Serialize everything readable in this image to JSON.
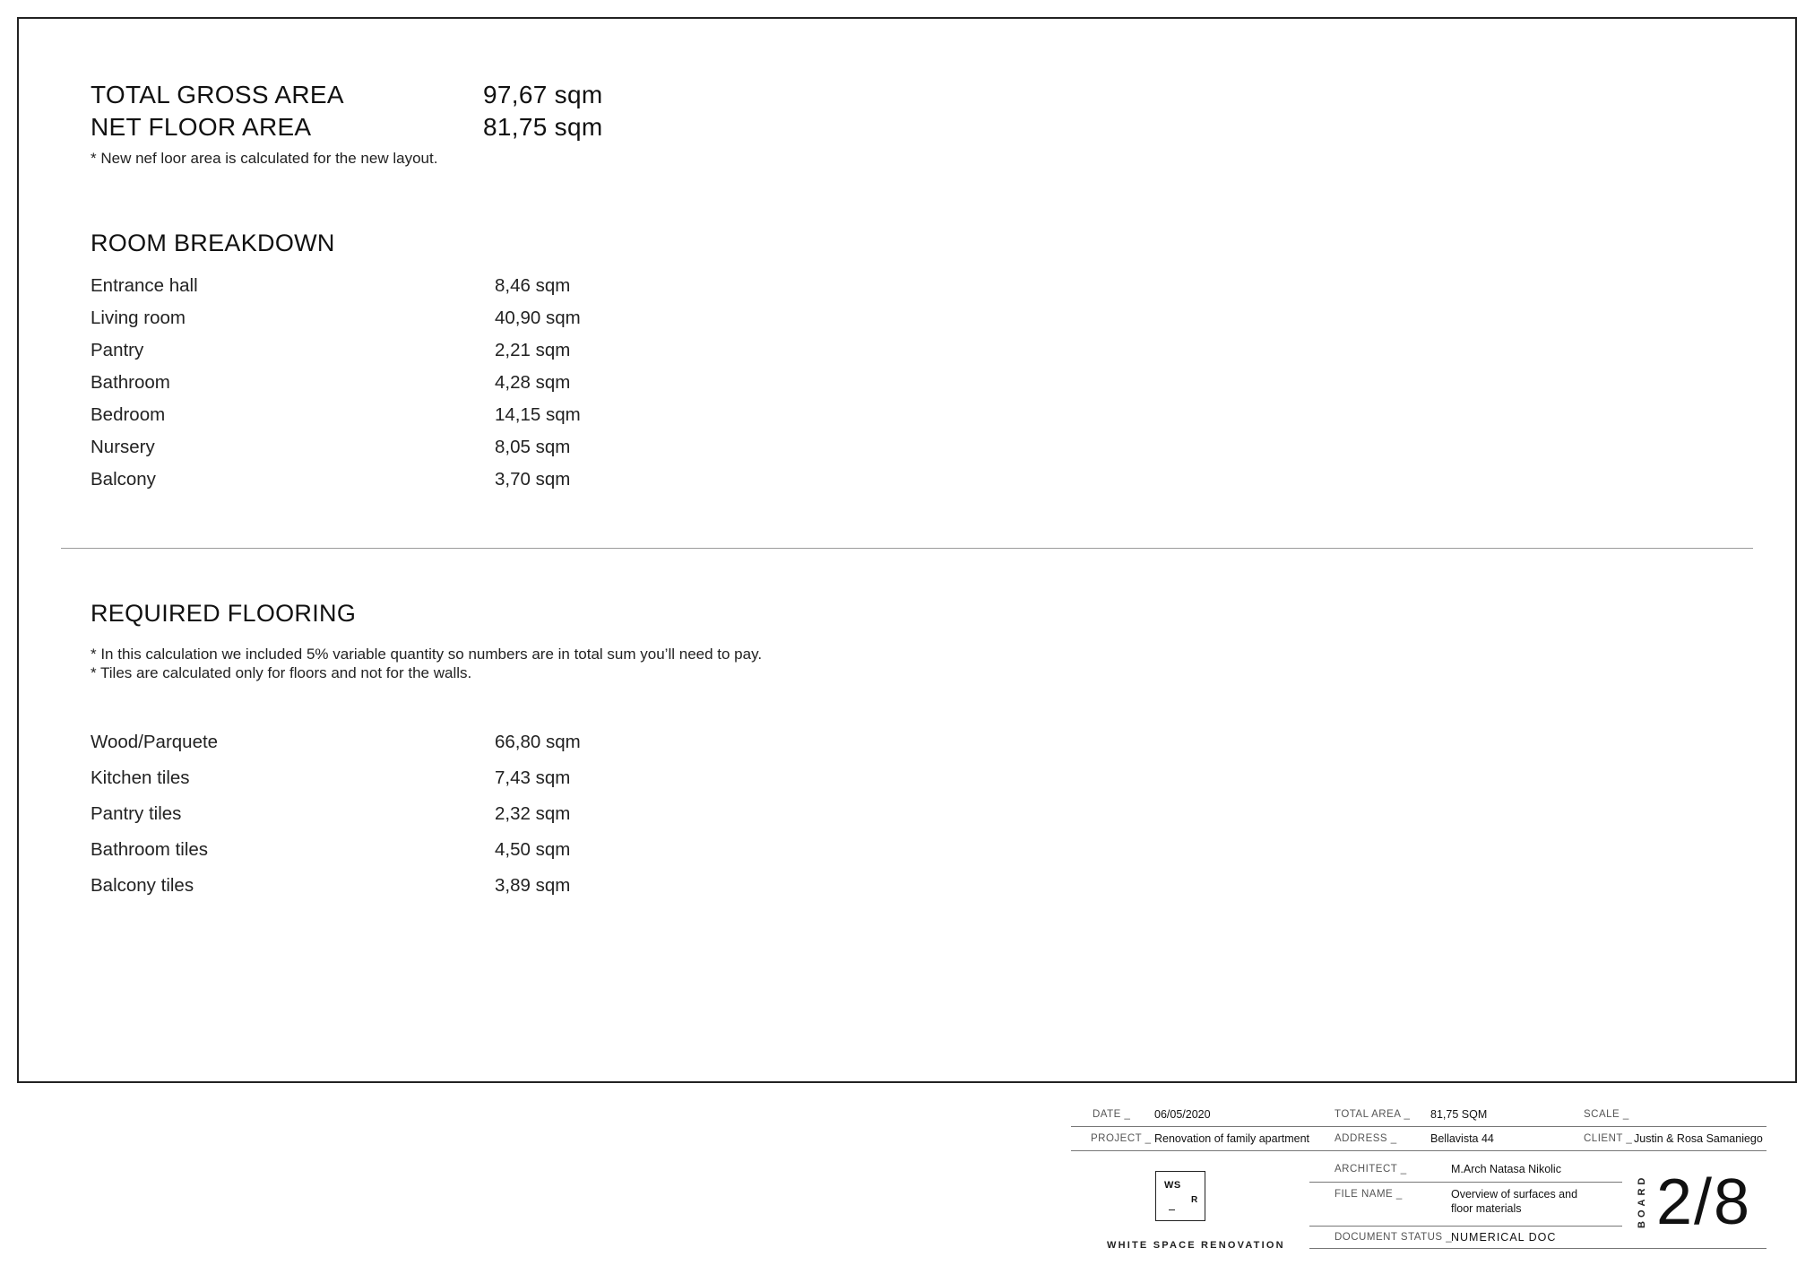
{
  "summary": {
    "gross_label": "TOTAL GROSS AREA",
    "gross_value": "97,67 sqm",
    "net_label": "NET FLOOR AREA",
    "net_value": "81,75 sqm",
    "note": "* New nef loor area is calculated for the new layout."
  },
  "room_breakdown": {
    "title": "ROOM BREAKDOWN",
    "rows": [
      {
        "label": "Entrance hall",
        "value": "8,46 sqm"
      },
      {
        "label": "Living room",
        "value": "40,90 sqm"
      },
      {
        "label": "Pantry",
        "value": "2,21 sqm"
      },
      {
        "label": "Bathroom",
        "value": "4,28 sqm"
      },
      {
        "label": "Bedroom",
        "value": "14,15 sqm"
      },
      {
        "label": "Nursery",
        "value": "8,05 sqm"
      },
      {
        "label": "Balcony",
        "value": "3,70 sqm"
      }
    ]
  },
  "required_flooring": {
    "title": "REQUIRED FLOORING",
    "notes": [
      "* In this calculation we included 5% variable quantity so numbers are in total sum you’ll need to pay.",
      "* Tiles are calculated only for floors and not for the walls."
    ],
    "rows": [
      {
        "label": "Wood/Parquete",
        "value": "66,80 sqm"
      },
      {
        "label": "Kitchen tiles",
        "value": "7,43 sqm"
      },
      {
        "label": "Pantry tiles",
        "value": "2,32 sqm"
      },
      {
        "label": "Bathroom tiles",
        "value": "4,50 sqm"
      },
      {
        "label": "Balcony tiles",
        "value": "3,89 sqm"
      }
    ]
  },
  "title_block": {
    "date_label": "DATE _",
    "date_value": "06/05/2020",
    "total_area_label": "TOTAL AREA _",
    "total_area_value": "81,75 SQM",
    "scale_label": "SCALE _",
    "project_label": "PROJECT _",
    "project_value": "Renovation of family apartment",
    "address_label": "ADDRESS _",
    "address_value": "Bellavista 44",
    "client_label": "CLIENT _",
    "client_value": "Justin & Rosa Samaniego",
    "architect_label": "ARCHITECT _",
    "architect_value": "M.Arch Natasa Nikolic",
    "file_name_label": "FILE NAME _",
    "file_name_line1": "Overview of surfaces and",
    "file_name_line2": "floor materials",
    "status_label": "DOCUMENT STATUS _",
    "status_value": "NUMERICAL DOC",
    "logo_ws": "WS",
    "logo_r": "R",
    "company": "WHITE SPACE RENOVATION",
    "board_label": "BOARD",
    "board_number": "2/8"
  }
}
